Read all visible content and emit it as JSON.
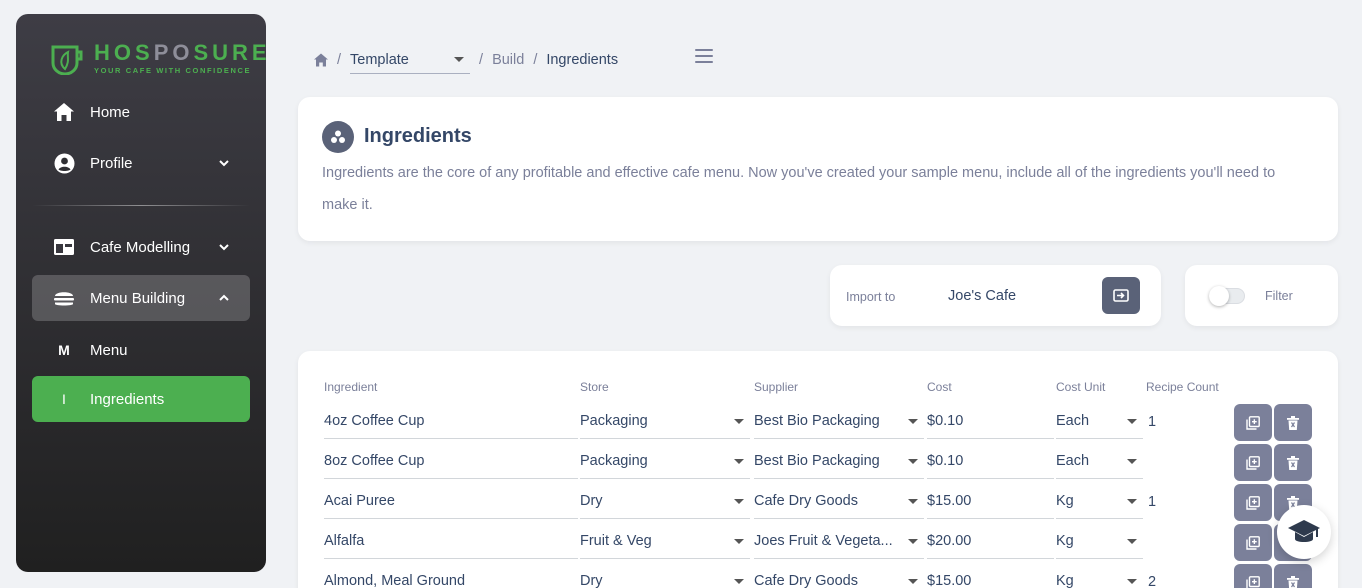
{
  "brand": {
    "name_part1": "HOS",
    "name_part2": "PO",
    "name_part3": "SURE",
    "tagline": "YOUR CAFE WITH CONFIDENCE",
    "accent_color": "#4caf50"
  },
  "sidebar": {
    "items": [
      {
        "label": "Home",
        "icon": "home-icon"
      },
      {
        "label": "Profile",
        "icon": "account-circle-icon"
      },
      {
        "label": "Cafe Modelling",
        "icon": "storefront-icon"
      },
      {
        "label": "Menu Building",
        "icon": "burger-icon"
      },
      {
        "label": "Menu",
        "letter": "M"
      },
      {
        "label": "Ingredients",
        "letter": "I"
      }
    ]
  },
  "breadcrumb": {
    "template_select": "Template",
    "build": "Build",
    "current": "Ingredients"
  },
  "intro": {
    "title": "Ingredients",
    "description": "Ingredients are the core of any profitable and effective cafe menu. Now you've created your sample menu, include all of the ingredients you'll need to make it."
  },
  "import": {
    "label": "Import to",
    "value": "Joe's Cafe"
  },
  "filter": {
    "label": "Filter",
    "enabled": false
  },
  "table": {
    "headers": [
      "Ingredient",
      "Store",
      "Supplier",
      "Cost",
      "Cost Unit",
      "Recipe Count"
    ],
    "rows": [
      {
        "ingredient": "4oz Coffee Cup",
        "store": "Packaging",
        "supplier": "Best Bio Packaging",
        "cost": "$0.10",
        "unit": "Each",
        "count": "1"
      },
      {
        "ingredient": "8oz Coffee Cup",
        "store": "Packaging",
        "supplier": "Best Bio Packaging",
        "cost": "$0.10",
        "unit": "Each",
        "count": ""
      },
      {
        "ingredient": "Acai Puree",
        "store": "Dry",
        "supplier": "Cafe Dry Goods",
        "cost": "$15.00",
        "unit": "Kg",
        "count": "1"
      },
      {
        "ingredient": "Alfalfa",
        "store": "Fruit & Veg",
        "supplier": "Joes Fruit & Vegeta...",
        "cost": "$20.00",
        "unit": "Kg",
        "count": ""
      },
      {
        "ingredient": "Almond, Meal Ground",
        "store": "Dry",
        "supplier": "Cafe Dry Goods",
        "cost": "$15.00",
        "unit": "Kg",
        "count": "2"
      }
    ]
  }
}
